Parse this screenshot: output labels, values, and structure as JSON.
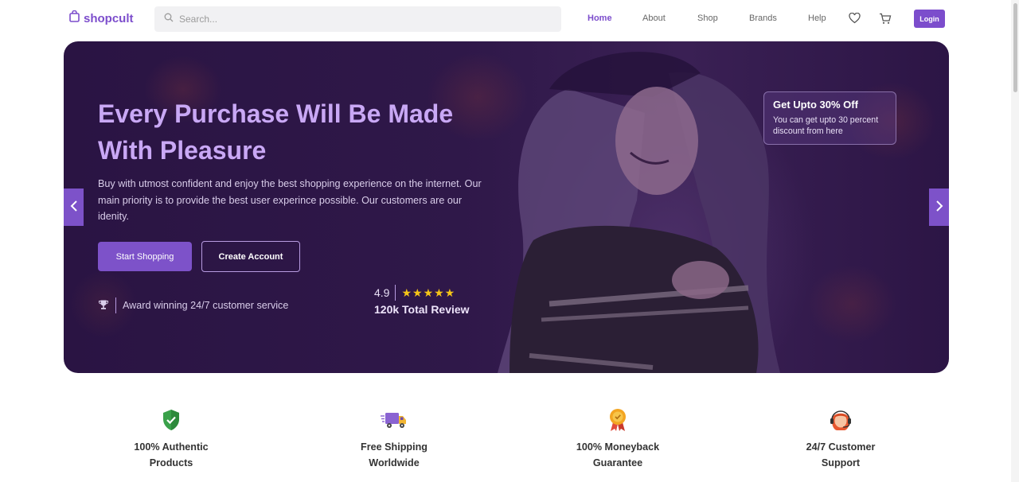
{
  "brand": {
    "name": "shopcult",
    "logo_icon": "shopping-bag-icon",
    "accent": "#7c4dcc"
  },
  "search": {
    "placeholder": "Search...",
    "value": ""
  },
  "nav": {
    "items": [
      {
        "label": "Home",
        "active": true
      },
      {
        "label": "About",
        "active": false
      },
      {
        "label": "Shop",
        "active": false
      },
      {
        "label": "Brands",
        "active": false
      },
      {
        "label": "Help",
        "active": false
      }
    ],
    "wishlist_icon": "heart-icon",
    "cart_icon": "cart-icon",
    "login_label": "Login"
  },
  "hero": {
    "title_line1": "Every Purchase Will Be Made",
    "title_line2": "With Pleasure",
    "description": "Buy with utmost confident and enjoy the best shopping experience on the internet. Our main priority is to provide the best user experince possible. Our customers are our idenity.",
    "primary_button": "Start Shopping",
    "secondary_button": "Create Account",
    "award_text": "Award winning 24/7 customer service",
    "award_icon": "trophy-icon",
    "rating_value": "4.9",
    "rating_stars": "★★★★★",
    "rating_total": "120k Total Review",
    "offer_title": "Get Upto 30% Off",
    "offer_text": "You can get upto 30 percent discount from here",
    "prev_icon": "chevron-left-icon",
    "next_icon": "chevron-right-icon"
  },
  "features": [
    {
      "icon": "shield-check-icon",
      "line1": "100% Authentic",
      "line2": "Products"
    },
    {
      "icon": "delivery-truck-icon",
      "line1": "Free Shipping",
      "line2": "Worldwide"
    },
    {
      "icon": "medal-icon",
      "line1": "100% Moneyback",
      "line2": "Guarantee"
    },
    {
      "icon": "support-agent-icon",
      "line1": "24/7 Customer",
      "line2": "Support"
    }
  ]
}
